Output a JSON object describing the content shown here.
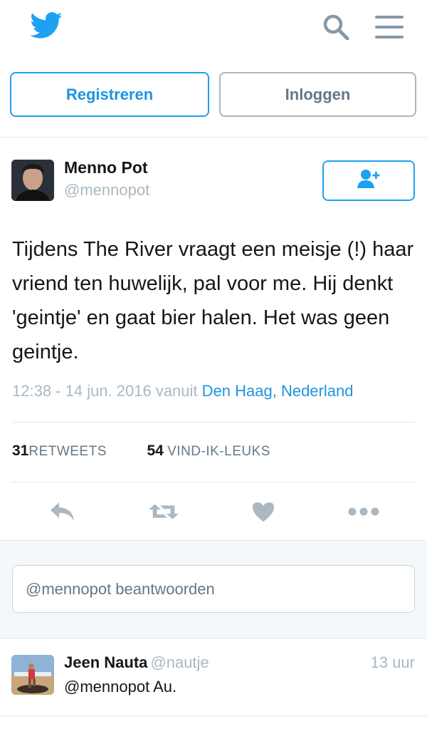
{
  "header": {
    "logo_icon": "twitter-bird-icon",
    "search_icon": "search-icon",
    "menu_icon": "hamburger-menu-icon",
    "brand_color": "#1da1f2"
  },
  "auth": {
    "register_label": "Registreren",
    "login_label": "Inloggen"
  },
  "tweet": {
    "author_name": "Menno Pot",
    "author_handle": "@mennopot",
    "follow_icon": "follow-user-icon",
    "text": "Tijdens The River vraagt een meisje (!) haar vriend ten huwelijk, pal voor me. Hij denkt 'geintje' en gaat bier halen. Het was geen geintje.",
    "timestamp": "12:38 - 14 jun. 2016 vanuit",
    "location": "Den Haag, Nederland",
    "retweets_count": "31",
    "retweets_label": "RETWEETS",
    "likes_count": "54",
    "likes_label": "VIND-IK-LEUKS",
    "actions": [
      "reply-icon",
      "retweet-icon",
      "heart-icon",
      "more-icon"
    ]
  },
  "reply_box": {
    "placeholder": "@mennopot beantwoorden"
  },
  "replies": [
    {
      "author_name": "Jeen Nauta",
      "author_handle": "@nautje",
      "time": "13 uur",
      "text": "@mennopot Au."
    }
  ]
}
